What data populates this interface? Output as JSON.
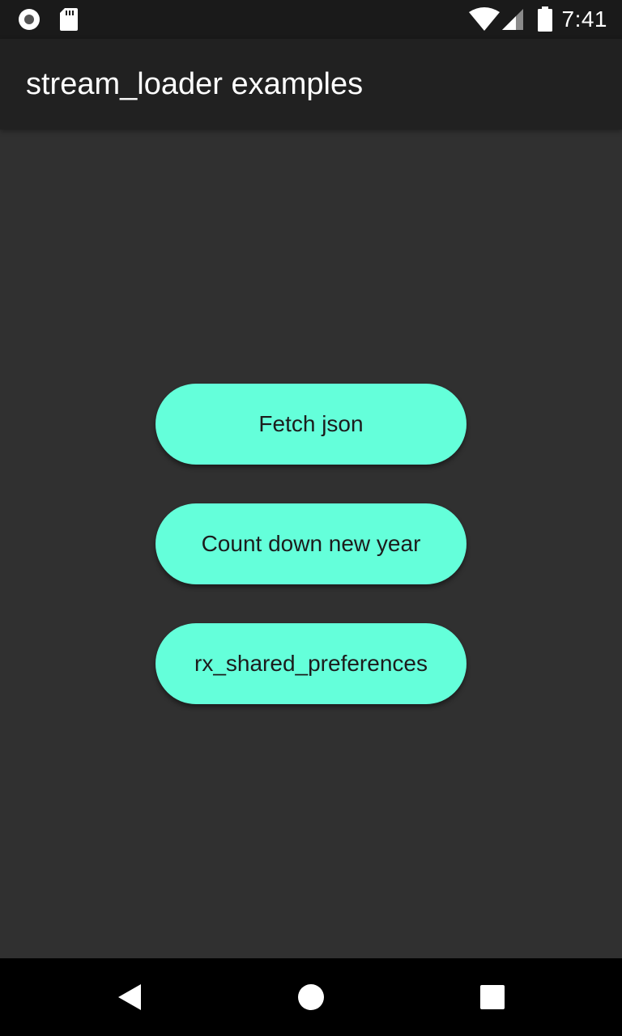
{
  "status_bar": {
    "time": "7:41",
    "icons": [
      "record-icon",
      "sd-card-icon",
      "wifi-icon",
      "signal-icon",
      "battery-icon"
    ]
  },
  "app_bar": {
    "title": "stream_loader examples"
  },
  "buttons": [
    {
      "label": "Fetch json"
    },
    {
      "label": "Count down new year"
    },
    {
      "label": "rx_shared_preferences"
    }
  ],
  "nav_bar": {
    "icons": [
      "back-icon",
      "home-icon",
      "recents-icon"
    ]
  },
  "colors": {
    "accent": "#64ffda",
    "background": "#303030",
    "app_bar": "#212121",
    "status_bar": "#1a1a1a"
  }
}
